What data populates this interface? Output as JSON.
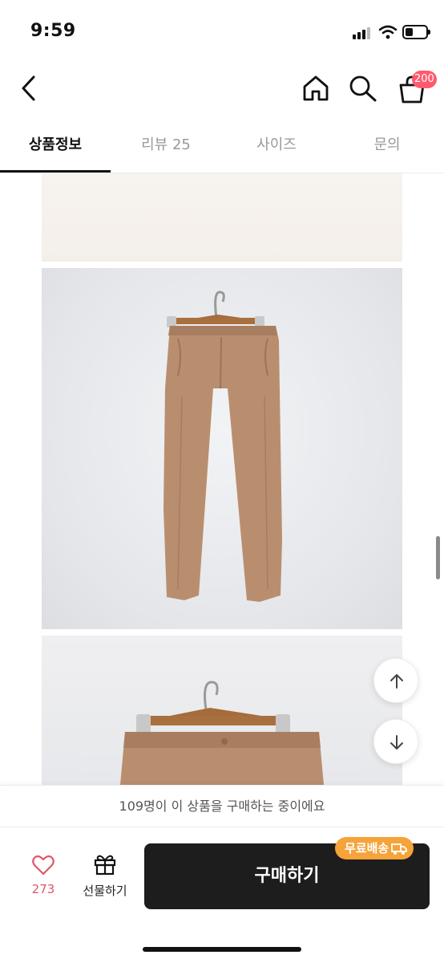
{
  "status_bar": {
    "time": "9:59"
  },
  "header": {
    "cart_badge": "200"
  },
  "tabs": [
    {
      "label": "상품정보",
      "active": true
    },
    {
      "label": "리뷰 25",
      "active": false
    },
    {
      "label": "사이즈",
      "active": false
    },
    {
      "label": "문의",
      "active": false
    }
  ],
  "notice": {
    "text": "109명이 이 상품을 구매하는 중이에요"
  },
  "bottom_bar": {
    "like_count": "273",
    "gift_label": "선물하기",
    "buy_label": "구매하기",
    "shipping_badge": "무료배송"
  },
  "colors": {
    "badge": "#ff5a6e",
    "like": "#e0566a",
    "shipping": "#f5a33a",
    "buy_button": "#1d1d1d"
  }
}
